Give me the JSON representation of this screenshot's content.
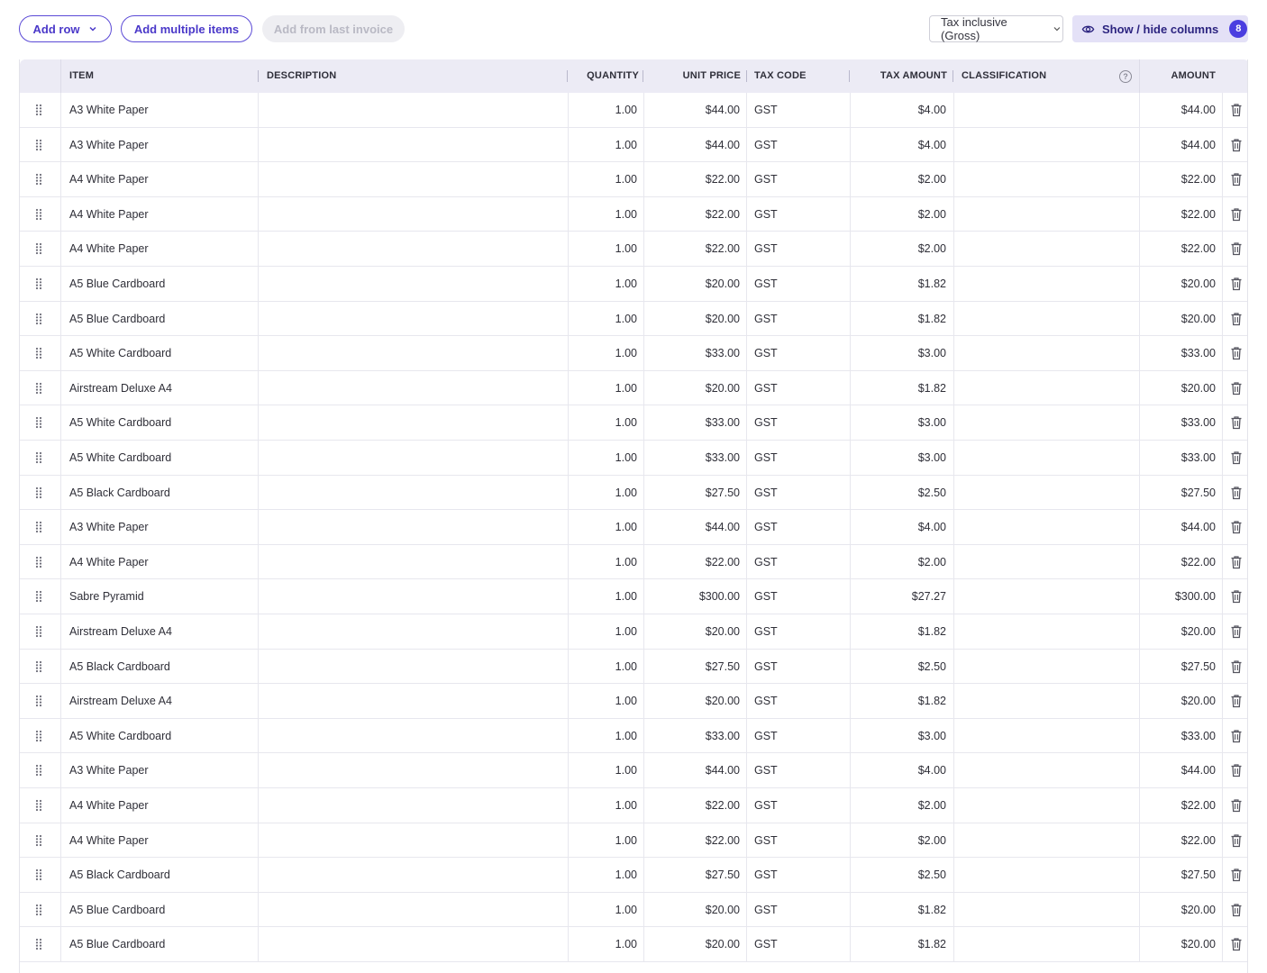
{
  "toolbar": {
    "add_row": "Add row",
    "add_multiple": "Add multiple items",
    "add_from_last": "Add from last invoice",
    "tax_mode": "Tax inclusive (Gross)",
    "show_hide": "Show / hide columns",
    "show_hide_count": "8"
  },
  "columns": {
    "item": "ITEM",
    "description": "DESCRIPTION",
    "quantity": "QUANTITY",
    "unit_price": "UNIT PRICE",
    "tax_code": "TAX CODE",
    "tax_amount": "TAX AMOUNT",
    "classification": "CLASSIFICATION",
    "amount": "AMOUNT"
  },
  "icons": {
    "drag": "drag-handle-icon",
    "delete": "trash-icon",
    "help": "help-circle-icon",
    "eye": "eye-icon",
    "chevron": "chevron-down-icon"
  },
  "colors": {
    "accent": "#4b3ee0",
    "header_bg": "#ecebf5",
    "showhide_bg": "#e4e1f7"
  },
  "rows": [
    {
      "item": "A3 White Paper",
      "description": "",
      "quantity": "1.00",
      "unit_price": "$44.00",
      "tax_code": "GST",
      "tax_amount": "$4.00",
      "classification": "",
      "amount": "$44.00"
    },
    {
      "item": "A3 White Paper",
      "description": "",
      "quantity": "1.00",
      "unit_price": "$44.00",
      "tax_code": "GST",
      "tax_amount": "$4.00",
      "classification": "",
      "amount": "$44.00"
    },
    {
      "item": "A4 White Paper",
      "description": "",
      "quantity": "1.00",
      "unit_price": "$22.00",
      "tax_code": "GST",
      "tax_amount": "$2.00",
      "classification": "",
      "amount": "$22.00"
    },
    {
      "item": "A4 White Paper",
      "description": "",
      "quantity": "1.00",
      "unit_price": "$22.00",
      "tax_code": "GST",
      "tax_amount": "$2.00",
      "classification": "",
      "amount": "$22.00"
    },
    {
      "item": "A4 White Paper",
      "description": "",
      "quantity": "1.00",
      "unit_price": "$22.00",
      "tax_code": "GST",
      "tax_amount": "$2.00",
      "classification": "",
      "amount": "$22.00"
    },
    {
      "item": "A5 Blue Cardboard",
      "description": "",
      "quantity": "1.00",
      "unit_price": "$20.00",
      "tax_code": "GST",
      "tax_amount": "$1.82",
      "classification": "",
      "amount": "$20.00"
    },
    {
      "item": "A5 Blue Cardboard",
      "description": "",
      "quantity": "1.00",
      "unit_price": "$20.00",
      "tax_code": "GST",
      "tax_amount": "$1.82",
      "classification": "",
      "amount": "$20.00"
    },
    {
      "item": "A5 White Cardboard",
      "description": "",
      "quantity": "1.00",
      "unit_price": "$33.00",
      "tax_code": "GST",
      "tax_amount": "$3.00",
      "classification": "",
      "amount": "$33.00"
    },
    {
      "item": "Airstream Deluxe A4",
      "description": "",
      "quantity": "1.00",
      "unit_price": "$20.00",
      "tax_code": "GST",
      "tax_amount": "$1.82",
      "classification": "",
      "amount": "$20.00"
    },
    {
      "item": "A5 White Cardboard",
      "description": "",
      "quantity": "1.00",
      "unit_price": "$33.00",
      "tax_code": "GST",
      "tax_amount": "$3.00",
      "classification": "",
      "amount": "$33.00"
    },
    {
      "item": "A5 White Cardboard",
      "description": "",
      "quantity": "1.00",
      "unit_price": "$33.00",
      "tax_code": "GST",
      "tax_amount": "$3.00",
      "classification": "",
      "amount": "$33.00"
    },
    {
      "item": "A5 Black Cardboard",
      "description": "",
      "quantity": "1.00",
      "unit_price": "$27.50",
      "tax_code": "GST",
      "tax_amount": "$2.50",
      "classification": "",
      "amount": "$27.50"
    },
    {
      "item": "A3 White Paper",
      "description": "",
      "quantity": "1.00",
      "unit_price": "$44.00",
      "tax_code": "GST",
      "tax_amount": "$4.00",
      "classification": "",
      "amount": "$44.00"
    },
    {
      "item": "A4 White Paper",
      "description": "",
      "quantity": "1.00",
      "unit_price": "$22.00",
      "tax_code": "GST",
      "tax_amount": "$2.00",
      "classification": "",
      "amount": "$22.00"
    },
    {
      "item": "Sabre Pyramid",
      "description": "",
      "quantity": "1.00",
      "unit_price": "$300.00",
      "tax_code": "GST",
      "tax_amount": "$27.27",
      "classification": "",
      "amount": "$300.00"
    },
    {
      "item": "Airstream Deluxe A4",
      "description": "",
      "quantity": "1.00",
      "unit_price": "$20.00",
      "tax_code": "GST",
      "tax_amount": "$1.82",
      "classification": "",
      "amount": "$20.00"
    },
    {
      "item": "A5 Black Cardboard",
      "description": "",
      "quantity": "1.00",
      "unit_price": "$27.50",
      "tax_code": "GST",
      "tax_amount": "$2.50",
      "classification": "",
      "amount": "$27.50"
    },
    {
      "item": "Airstream Deluxe A4",
      "description": "",
      "quantity": "1.00",
      "unit_price": "$20.00",
      "tax_code": "GST",
      "tax_amount": "$1.82",
      "classification": "",
      "amount": "$20.00"
    },
    {
      "item": "A5 White Cardboard",
      "description": "",
      "quantity": "1.00",
      "unit_price": "$33.00",
      "tax_code": "GST",
      "tax_amount": "$3.00",
      "classification": "",
      "amount": "$33.00"
    },
    {
      "item": "A3 White Paper",
      "description": "",
      "quantity": "1.00",
      "unit_price": "$44.00",
      "tax_code": "GST",
      "tax_amount": "$4.00",
      "classification": "",
      "amount": "$44.00"
    },
    {
      "item": "A4 White Paper",
      "description": "",
      "quantity": "1.00",
      "unit_price": "$22.00",
      "tax_code": "GST",
      "tax_amount": "$2.00",
      "classification": "",
      "amount": "$22.00"
    },
    {
      "item": "A4 White Paper",
      "description": "",
      "quantity": "1.00",
      "unit_price": "$22.00",
      "tax_code": "GST",
      "tax_amount": "$2.00",
      "classification": "",
      "amount": "$22.00"
    },
    {
      "item": "A5 Black Cardboard",
      "description": "",
      "quantity": "1.00",
      "unit_price": "$27.50",
      "tax_code": "GST",
      "tax_amount": "$2.50",
      "classification": "",
      "amount": "$27.50"
    },
    {
      "item": "A5 Blue Cardboard",
      "description": "",
      "quantity": "1.00",
      "unit_price": "$20.00",
      "tax_code": "GST",
      "tax_amount": "$1.82",
      "classification": "",
      "amount": "$20.00"
    },
    {
      "item": "A5 Blue Cardboard",
      "description": "",
      "quantity": "1.00",
      "unit_price": "$20.00",
      "tax_code": "GST",
      "tax_amount": "$1.82",
      "classification": "",
      "amount": "$20.00"
    }
  ]
}
